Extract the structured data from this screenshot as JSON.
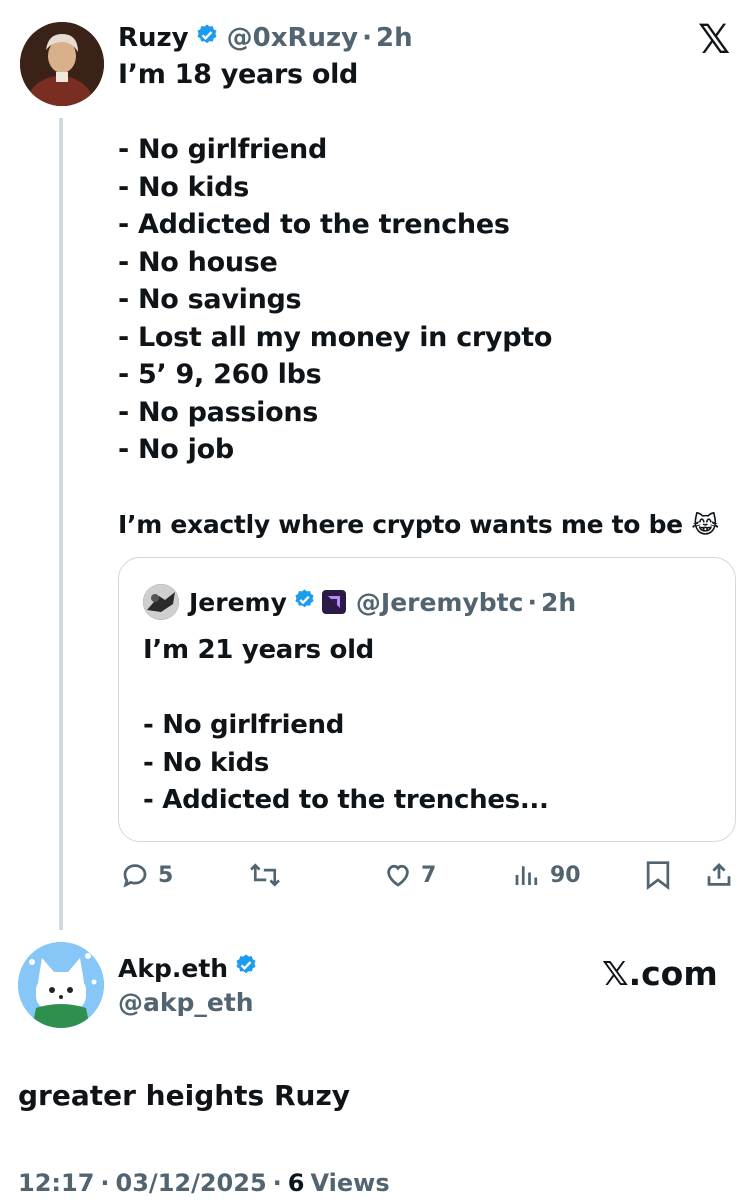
{
  "main_tweet": {
    "display_name": "Ruzy",
    "handle": "@0xRuzy",
    "separator": "·",
    "time": "2h",
    "lines": [
      "I’m 18 years old",
      "",
      "- No girlfriend",
      "- No kids",
      "- Addicted to the trenches",
      "- No house",
      "- No savings",
      "- Lost all my money in crypto",
      "- 5’ 9, 260 lbs",
      "- No passions",
      "- No job",
      "",
      "I’m exactly where crypto wants me to be"
    ],
    "emoji": "😹"
  },
  "quoted_tweet": {
    "display_name": "Jeremy",
    "handle": "@Jeremybtc",
    "separator": "·",
    "time": "2h",
    "lines": [
      "I’m 21 years old",
      "",
      "- No girlfriend",
      "- No kids",
      "- Addicted to the trenches..."
    ]
  },
  "actions": {
    "replies": "5",
    "retweets": "",
    "likes": "7",
    "views": "90"
  },
  "reply": {
    "display_name": "Akp.eth",
    "handle": "@akp_eth",
    "text": "greater heights Ruzy",
    "time": "12:17",
    "date": "03/12/2025",
    "separator": "·",
    "views_count": "6",
    "views_label": "Views"
  },
  "branding": {
    "x_logo": "𝕏",
    "x_com": "𝕏.com"
  },
  "icons": {
    "verified": "verified-badge-icon",
    "reply": "reply-bubble-icon",
    "retweet": "retweet-icon",
    "like": "heart-icon",
    "views": "bar-chart-icon",
    "bookmark": "bookmark-icon",
    "share": "share-icon"
  },
  "colors": {
    "verified_blue": "#1d9bf0",
    "text": "#0f1419",
    "secondary": "#536471",
    "thread_line": "#cfd9de"
  }
}
